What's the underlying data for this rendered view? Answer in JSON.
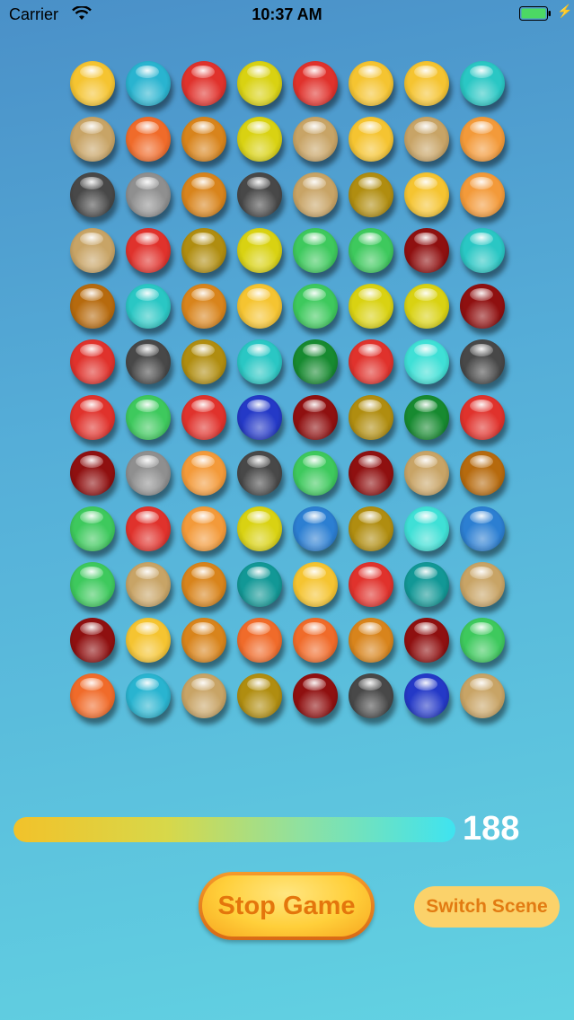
{
  "status_bar": {
    "carrier": "Carrier",
    "time": "10:37 AM"
  },
  "game": {
    "columns": 8,
    "rows": 12,
    "palette": {
      "yellow": "#f5c431",
      "cyan": "#29b4d0",
      "red": "#e0322c",
      "lime": "#d9d212",
      "tan": "#c8a466",
      "orange": "#f06b2a",
      "amber": "#d8841c",
      "darkgray": "#484848",
      "gray": "#8f8f8f",
      "olive": "#b08d10",
      "green": "#3ec95d",
      "darkred": "#8f1010",
      "teal": "#2ac7c4",
      "brown": "#b66a0e",
      "darkgreen": "#178a30",
      "blue": "#2439c7",
      "skyblue": "#2c7fd2",
      "lightcyan": "#3fe0d6",
      "deepteal": "#129896",
      "peach": "#f39a3a"
    },
    "grid": [
      [
        "yellow",
        "cyan",
        "red",
        "lime",
        "red",
        "yellow",
        "yellow",
        "teal"
      ],
      [
        "tan",
        "orange",
        "amber",
        "lime",
        "tan",
        "yellow",
        "tan",
        "peach"
      ],
      [
        "darkgray",
        "gray",
        "amber",
        "darkgray",
        "tan",
        "olive",
        "yellow",
        "peach"
      ],
      [
        "tan",
        "red",
        "olive",
        "lime",
        "green",
        "green",
        "darkred",
        "teal"
      ],
      [
        "brown",
        "teal",
        "amber",
        "yellow",
        "green",
        "lime",
        "lime",
        "darkred"
      ],
      [
        "red",
        "darkgray",
        "olive",
        "teal",
        "darkgreen",
        "red",
        "lightcyan",
        "darkgray"
      ],
      [
        "red",
        "green",
        "red",
        "blue",
        "darkred",
        "olive",
        "darkgreen",
        "red"
      ],
      [
        "darkred",
        "gray",
        "peach",
        "darkgray",
        "green",
        "darkred",
        "tan",
        "brown"
      ],
      [
        "green",
        "red",
        "peach",
        "lime",
        "skyblue",
        "olive",
        "lightcyan",
        "skyblue"
      ],
      [
        "green",
        "tan",
        "amber",
        "deepteal",
        "yellow",
        "red",
        "deepteal",
        "tan"
      ],
      [
        "darkred",
        "yellow",
        "amber",
        "orange",
        "orange",
        "amber",
        "darkred",
        "green"
      ],
      [
        "orange",
        "cyan",
        "tan",
        "olive",
        "darkred",
        "darkgray",
        "blue",
        "tan"
      ]
    ],
    "timer_fraction": 1.0,
    "score": "188"
  },
  "controls": {
    "stop_label": "Stop Game",
    "switch_label": "Switch Scene"
  }
}
